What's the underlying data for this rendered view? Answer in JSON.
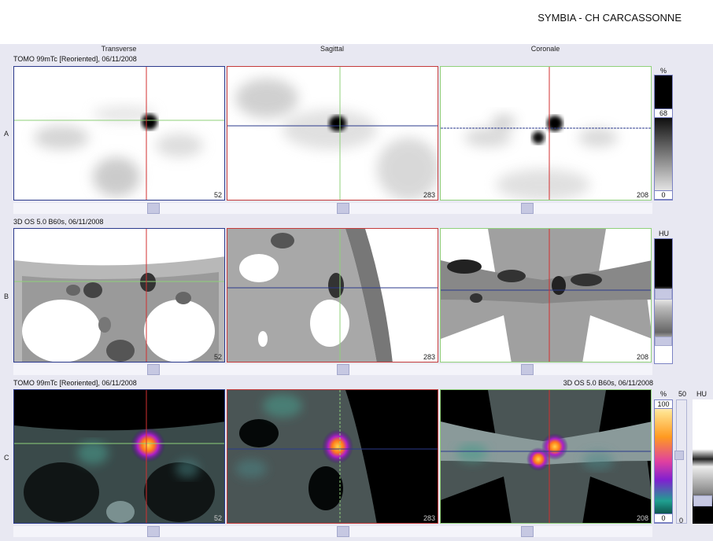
{
  "app": {
    "title": "SYMBIA - CH CARCASSONNE"
  },
  "columns": [
    "Transverse",
    "Sagittal",
    "Coronale"
  ],
  "rows": [
    {
      "label": "A",
      "info": "TOMO 99mTc [Reoriented], 06/11/2008",
      "info_right": "",
      "slices": [
        "52",
        "283",
        "208"
      ]
    },
    {
      "label": "B",
      "info": "3D  OS  5.0  B60s, 06/11/2008",
      "info_right": "",
      "slices": [
        "52",
        "283",
        "208"
      ]
    },
    {
      "label": "C",
      "info": "TOMO 99mTc [Reoriented], 06/11/2008",
      "info_right": "3D  OS  5.0  B60s, 06/11/2008",
      "slices": [
        "52",
        "283",
        "208"
      ]
    }
  ],
  "scales": {
    "a": {
      "unit": "%",
      "value": "68",
      "min": "0"
    },
    "b": {
      "unit": "HU"
    },
    "c": {
      "unit": "%",
      "max": "100",
      "min": "0",
      "level": "50",
      "level_min": "0",
      "unit_right": "HU"
    }
  },
  "colors": {
    "transverse_frame": "#2b3a8c",
    "sagittal_frame": "#c43a3a",
    "coronal_frame": "#8fd07a",
    "crosshair_red": "#d33030",
    "crosshair_green": "#8fd07a",
    "crosshair_blue": "#2b3a8c"
  }
}
